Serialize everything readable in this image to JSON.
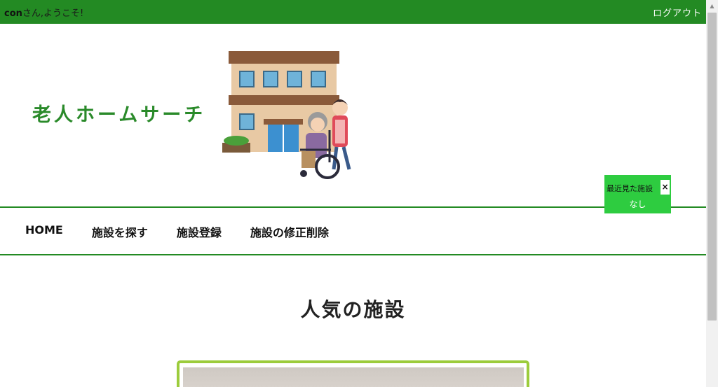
{
  "topbar": {
    "username": "con",
    "welcome_text": "さん,ようこそ!",
    "logout_label": "ログアウト"
  },
  "site": {
    "title": "老人ホームサーチ"
  },
  "nav": {
    "items": [
      {
        "label": "HOME"
      },
      {
        "label": "施設を探す"
      },
      {
        "label": "施設登録"
      },
      {
        "label": "施設の修正削除"
      }
    ]
  },
  "recent": {
    "title": "最近見た施設",
    "close_icon": "×",
    "content": "なし"
  },
  "main": {
    "section_title": "人気の施設"
  },
  "colors": {
    "header_green": "#238a23",
    "title_green": "#2a8a2a",
    "recent_green": "#2ecc40",
    "card_border": "#9ccc3c"
  }
}
